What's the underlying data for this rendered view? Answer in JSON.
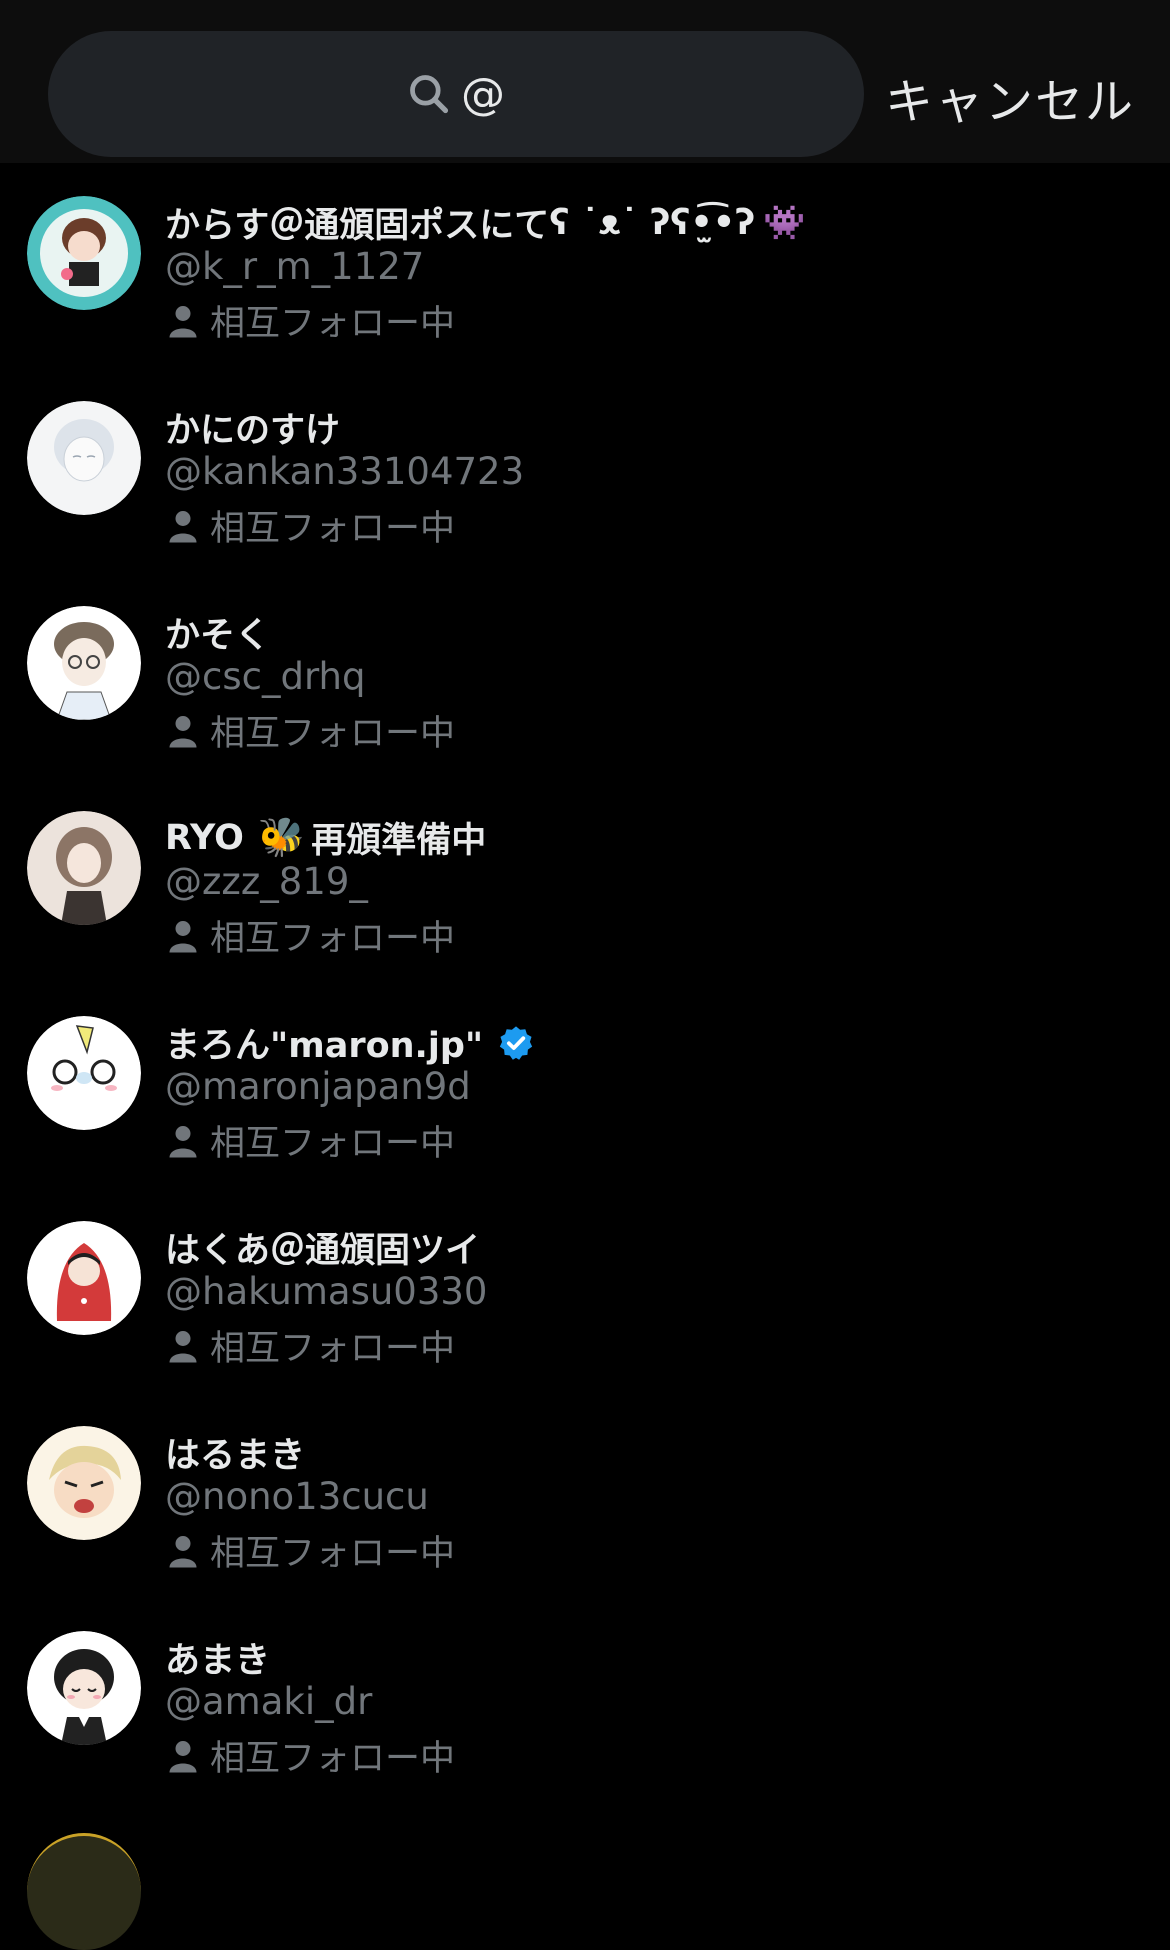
{
  "search": {
    "query": "@",
    "icon": "search-icon",
    "cancel_label": "キャンセル"
  },
  "users": [
    {
      "name": "からす＠通頒固ポスにて",
      "name_suffix": "ʕ ˙ᴥ˙ ʔʕ•̫͡•ʔ",
      "emoji": "👾",
      "handle": "@k_r_m_1127",
      "mutual": "相互フォロー中"
    },
    {
      "name": "かにのすけ",
      "handle": "@kankan33104723",
      "mutual": "相互フォロー中"
    },
    {
      "name": "かそく",
      "handle": "@csc_drhq",
      "mutual": "相互フォロー中"
    },
    {
      "name": "RYO",
      "emoji": "🐝",
      "name_after": "再頒準備中",
      "handle": "@zzz_819_",
      "mutual": "相互フォロー中"
    },
    {
      "name": "まろん\"maron.jp\"",
      "verified": true,
      "handle": "@maronjapan9d",
      "mutual": "相互フォロー中"
    },
    {
      "name": "はくあ＠通頒固ツイ",
      "handle": "@hakumasu0330",
      "mutual": "相互フォロー中"
    },
    {
      "name": "はるまき",
      "handle": "@nono13cucu",
      "mutual": "相互フォロー中"
    },
    {
      "name": "あまき",
      "handle": "@amaki_dr",
      "mutual": "相互フォロー中"
    }
  ],
  "colors": {
    "background": "#000000",
    "search_bg": "#202327",
    "secondary_text": "#71767b",
    "verified": "#1d9bf0"
  }
}
